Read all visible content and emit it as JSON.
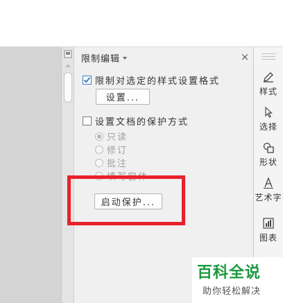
{
  "panel": {
    "title": "限制编辑",
    "close": "×",
    "format_section": {
      "checkbox_label": "限制对选定的样式设置格式",
      "checked": true,
      "settings_button": "设置..."
    },
    "protect_section": {
      "checkbox_label": "设置文档的保护方式",
      "checked": false,
      "options": [
        {
          "label": "只读",
          "selected": true
        },
        {
          "label": "修订",
          "selected": false
        },
        {
          "label": "批注",
          "selected": false
        },
        {
          "label": "填写窗体",
          "selected": false
        }
      ],
      "start_button": "启动保护..."
    }
  },
  "sidebar": {
    "items": [
      {
        "label": "样式",
        "icon": "pen-icon"
      },
      {
        "label": "选择",
        "icon": "cursor-icon"
      },
      {
        "label": "形状",
        "icon": "shape-icon"
      },
      {
        "label": "艺术字",
        "icon": "wordart-icon"
      },
      {
        "label": "图表",
        "icon": "chart-icon"
      }
    ]
  },
  "watermark": {
    "title": "百科全说",
    "subtitle": "助你轻松解决"
  },
  "colors": {
    "highlight_box": "#e8212b",
    "watermark_green": "#1a9a3e",
    "checkbox_accent": "#3c7fc7"
  }
}
